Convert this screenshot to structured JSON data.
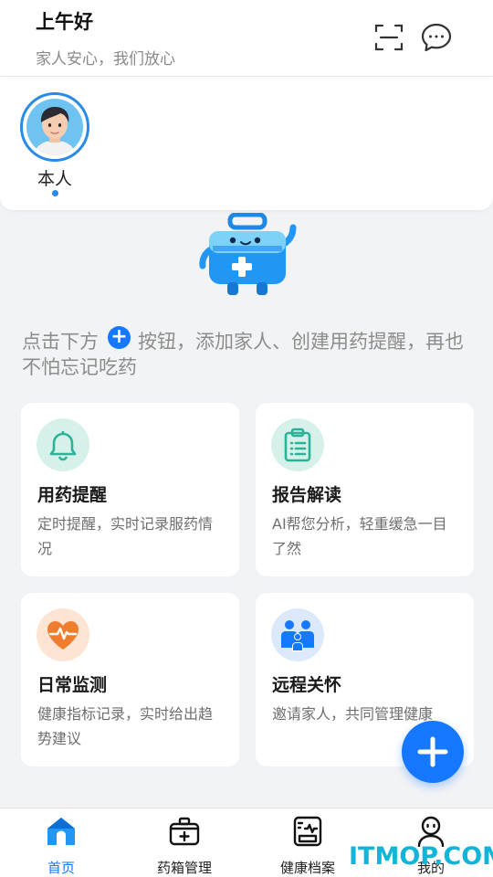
{
  "header": {
    "greeting": "上午好",
    "subtitle": "家人安心，我们放心"
  },
  "members": [
    {
      "name": "本人",
      "selected": true
    }
  ],
  "hint": {
    "before": "点击下方",
    "after": "按钮，添加家人、创建用药提醒，再也不怕忘记吃药"
  },
  "cards": [
    {
      "title": "用药提醒",
      "desc": "定时提醒，实时记录服药情况",
      "icon": "bell-icon"
    },
    {
      "title": "报告解读",
      "desc": "AI帮您分析，轻重缓急一目了然",
      "icon": "clipboard-icon"
    },
    {
      "title": "日常监测",
      "desc": "健康指标记录，实时给出趋势建议",
      "icon": "heart-pulse-icon"
    },
    {
      "title": "远程关怀",
      "desc": "邀请家人，共同管理健康",
      "icon": "family-icon"
    }
  ],
  "tabs": [
    {
      "label": "首页",
      "active": true
    },
    {
      "label": "药箱管理"
    },
    {
      "label": "健康档案"
    },
    {
      "label": "我的"
    }
  ],
  "watermark": "ITMOP.COM",
  "colors": {
    "accent": "#1677ff",
    "teal": "#2bb39a",
    "orange": "#f07d2e"
  }
}
